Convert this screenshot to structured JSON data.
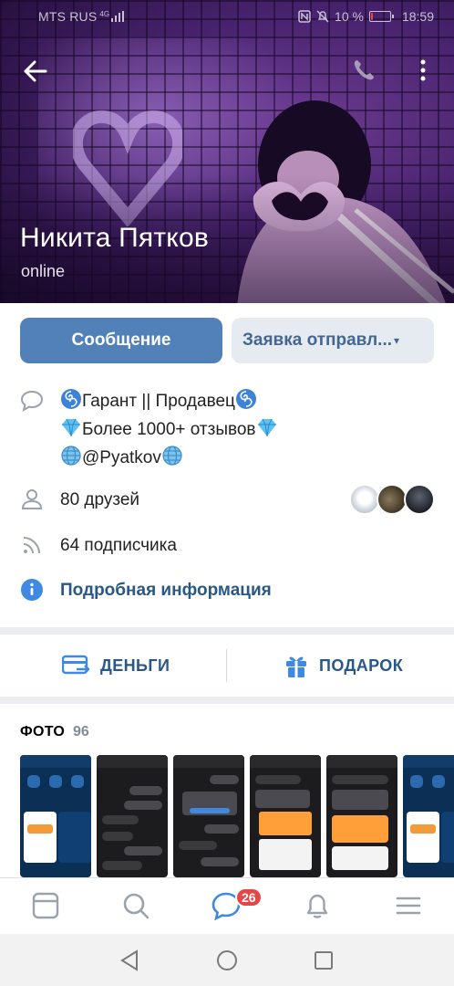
{
  "status_bar": {
    "carrier": "MTS RUS",
    "network": "4G",
    "battery": "10 %",
    "battery_level": 0.1,
    "time": "18:59"
  },
  "profile": {
    "name": "Никита Пятков",
    "status": "online"
  },
  "buttons": {
    "message": "Сообщение",
    "request": "Заявка отправл..."
  },
  "about": {
    "line1": "Гарант || Продавец",
    "line2": "Более 1000+ отзывов",
    "line3": "@Pyatkov"
  },
  "friends": {
    "label": "80 друзей"
  },
  "followers": {
    "label": "64 подписчика"
  },
  "details": {
    "label": "Подробная информация"
  },
  "actions": {
    "money": "ДЕНЬГИ",
    "gift": "ПОДАРОК"
  },
  "photos": {
    "title": "ФОТО",
    "count": "96"
  },
  "tabbar": {
    "messages_badge": "26"
  },
  "colors": {
    "accent": "#5181b8",
    "link": "#2a5885",
    "badge": "#e64646"
  },
  "icons": {
    "back": "arrow-left-icon",
    "call": "phone-icon",
    "more": "more-vertical-icon",
    "status": "speech-bubble-icon",
    "friends": "person-icon",
    "followers": "rss-icon",
    "info": "info-icon",
    "money": "card-arrow-icon",
    "gift": "gift-icon",
    "tab_news": "newsfeed-icon",
    "tab_search": "search-icon",
    "tab_messages": "messages-icon",
    "tab_notifications": "bell-icon",
    "tab_menu": "menu-icon"
  }
}
